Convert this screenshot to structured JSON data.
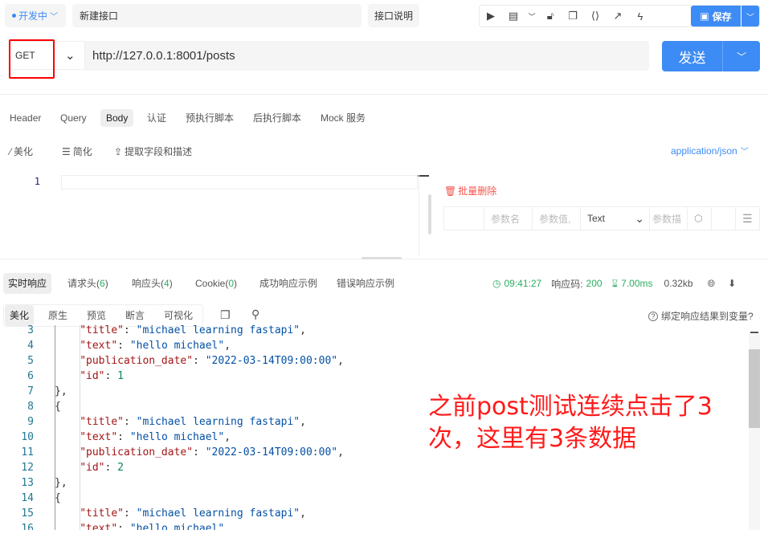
{
  "top": {
    "env": "开发中",
    "name": "新建接口",
    "doc_button": "接口说明",
    "save": "保存"
  },
  "request": {
    "method": "GET",
    "url": "http://127.0.0.1:8001/posts",
    "send": "发送"
  },
  "req_tabs": [
    "Header",
    "Query",
    "Body",
    "认证",
    "预执行脚本",
    "后执行脚本",
    "Mock 服务"
  ],
  "req_active": "Body",
  "body_tools": {
    "beautify": "美化",
    "simplify": "简化",
    "extract": "提取字段和描述",
    "content_type": "application/json"
  },
  "body_editor": {
    "line": "1"
  },
  "params": {
    "batch_delete": "批量删除",
    "name_ph": "参数名",
    "value_ph": "参数值,",
    "type": "Text",
    "desc_ph": "参数描"
  },
  "resp_tabs": [
    {
      "label": "实时响应"
    },
    {
      "label": "请求头(",
      "count": "6"
    },
    {
      "label": "响应头(",
      "count": "4"
    },
    {
      "label": "Cookie(",
      "count": "0"
    },
    {
      "label": "成功响应示例"
    },
    {
      "label": "错误响应示例"
    }
  ],
  "resp_status": {
    "time": "09:41:27",
    "code_label": "响应码:",
    "code": "200",
    "duration": "7.00ms",
    "size": "0.32kb"
  },
  "view_tabs": [
    "美化",
    "原生",
    "预览",
    "断言",
    "可视化"
  ],
  "bind_var": "绑定响应结果到变量?",
  "code_lines": [
    {
      "n": "3",
      "indent": 2,
      "key": "title",
      "val": "\"michael learning fastapi\"",
      "vt": "s",
      "tail": ","
    },
    {
      "n": "4",
      "indent": 2,
      "key": "text",
      "val": "\"hello michael\"",
      "vt": "s",
      "tail": ","
    },
    {
      "n": "5",
      "indent": 2,
      "key": "publication_date",
      "val": "\"2022-03-14T09:00:00\"",
      "vt": "s",
      "tail": ","
    },
    {
      "n": "6",
      "indent": 2,
      "key": "id",
      "val": "1",
      "vt": "num",
      "tail": ""
    },
    {
      "n": "7",
      "indent": 1,
      "punct": "},"
    },
    {
      "n": "8",
      "indent": 1,
      "punct": "{"
    },
    {
      "n": "9",
      "indent": 2,
      "key": "title",
      "val": "\"michael learning fastapi\"",
      "vt": "s",
      "tail": ","
    },
    {
      "n": "10",
      "indent": 2,
      "key": "text",
      "val": "\"hello michael\"",
      "vt": "s",
      "tail": ","
    },
    {
      "n": "11",
      "indent": 2,
      "key": "publication_date",
      "val": "\"2022-03-14T09:00:00\"",
      "vt": "s",
      "tail": ","
    },
    {
      "n": "12",
      "indent": 2,
      "key": "id",
      "val": "2",
      "vt": "num",
      "tail": ""
    },
    {
      "n": "13",
      "indent": 1,
      "punct": "},"
    },
    {
      "n": "14",
      "indent": 1,
      "punct": "{"
    },
    {
      "n": "15",
      "indent": 2,
      "key": "title",
      "val": "\"michael learning fastapi\"",
      "vt": "s",
      "tail": ","
    },
    {
      "n": "16",
      "indent": 2,
      "key": "text",
      "val": "\"hello michael\"",
      "vt": "s",
      "tail": ","
    }
  ],
  "annotation": {
    "line1": "之前post测试连续点击了3",
    "line2": "次，这里有3条数据",
    "color": "#ff1a1a"
  },
  "colors": {
    "accent": "#3d8bf5",
    "success": "#2bae5f",
    "danger": "#f5544c"
  }
}
